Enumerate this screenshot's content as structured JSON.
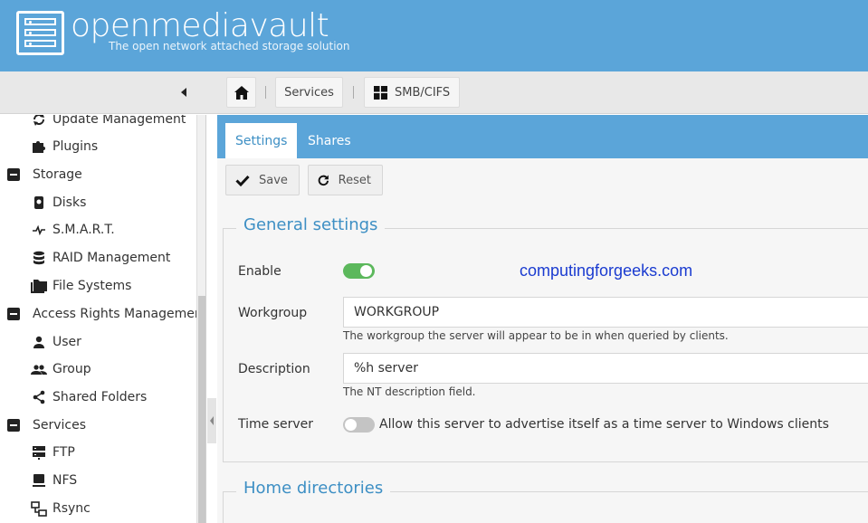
{
  "app": {
    "title": "openmediavault",
    "subtitle": "The open network attached storage solution"
  },
  "breadcrumb": {
    "services": "Services",
    "smb": "SMB/CIFS"
  },
  "sidebar": {
    "items": [
      {
        "label": "Update Management",
        "icon": "refresh-icon",
        "group": false
      },
      {
        "label": "Plugins",
        "icon": "puzzle-icon",
        "group": false
      },
      {
        "label": "Storage",
        "icon": "minus-box-icon",
        "group": true
      },
      {
        "label": "Disks",
        "icon": "disk-icon",
        "group": false
      },
      {
        "label": "S.M.A.R.T.",
        "icon": "pulse-icon",
        "group": false
      },
      {
        "label": "RAID Management",
        "icon": "database-icon",
        "group": false
      },
      {
        "label": "File Systems",
        "icon": "folders-icon",
        "group": false
      },
      {
        "label": "Access Rights Management",
        "icon": "minus-box-icon",
        "group": true
      },
      {
        "label": "User",
        "icon": "user-icon",
        "group": false
      },
      {
        "label": "Group",
        "icon": "group-icon",
        "group": false
      },
      {
        "label": "Shared Folders",
        "icon": "share-icon",
        "group": false
      },
      {
        "label": "Services",
        "icon": "minus-box-icon",
        "group": true
      },
      {
        "label": "FTP",
        "icon": "server-icon",
        "group": false
      },
      {
        "label": "NFS",
        "icon": "monitor-icon",
        "group": false
      },
      {
        "label": "Rsync",
        "icon": "sync-icon",
        "group": false
      }
    ]
  },
  "tabs": {
    "settings": "Settings",
    "shares": "Shares"
  },
  "actions": {
    "save": "Save",
    "reset": "Reset"
  },
  "general": {
    "legend": "General settings",
    "enable_label": "Enable",
    "enable_value": true,
    "workgroup_label": "Workgroup",
    "workgroup_value": "WORKGROUP",
    "workgroup_help": "The workgroup the server will appear to be in when queried by clients.",
    "description_label": "Description",
    "description_value": "%h server",
    "description_help": "The NT description field.",
    "timeserver_label": "Time server",
    "timeserver_value": false,
    "timeserver_text": "Allow this server to advertise itself as a time server to Windows clients"
  },
  "home": {
    "legend": "Home directories"
  },
  "watermark": "computingforgeeks.com",
  "colors": {
    "header": "#5ba5d9",
    "accent": "#3d8fc4",
    "toggle_on": "#5cb85c",
    "toggle_off": "#c4c4c4"
  }
}
